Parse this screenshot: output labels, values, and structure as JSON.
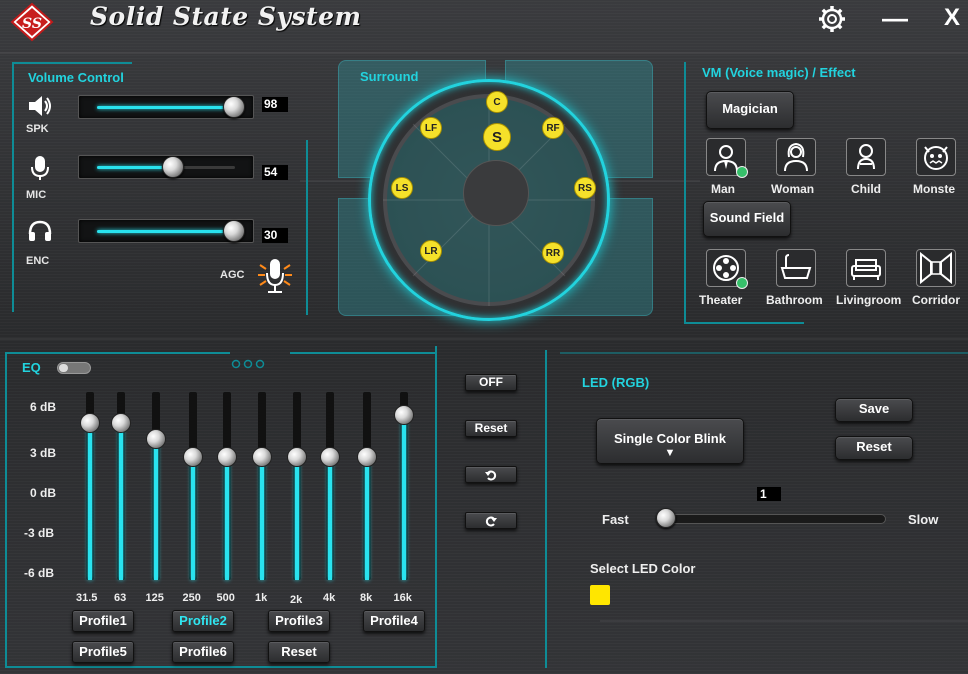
{
  "app": {
    "title": "Solid State System"
  },
  "window": {
    "settings_icon": "gear-icon",
    "minimize_label": "—",
    "close_label": "X"
  },
  "volume": {
    "title": "Volume Control",
    "channels": [
      {
        "label": "SPK",
        "value": "98",
        "level": 0.98,
        "icon": "speaker-icon"
      },
      {
        "label": "MIC",
        "value": "54",
        "level": 0.54,
        "icon": "microphone-icon"
      },
      {
        "label": "ENC",
        "value": "30",
        "level": 0.98,
        "icon": "headset-icon"
      }
    ],
    "agc_label": "AGC"
  },
  "surround": {
    "title": "Surround",
    "speakers": {
      "c": "C",
      "s": "S",
      "lf": "LF",
      "rf": "RF",
      "ls": "LS",
      "rs": "RS",
      "lr": "LR",
      "rr": "RR"
    },
    "speaker_color": "#f5e12a"
  },
  "vm": {
    "title": "VM (Voice magic) / Effect",
    "magician_label": "Magician",
    "voices": [
      {
        "label": "Man",
        "icon": "man-icon",
        "selected": true
      },
      {
        "label": "Woman",
        "icon": "woman-icon",
        "selected": false
      },
      {
        "label": "Child",
        "icon": "child-icon",
        "selected": false
      },
      {
        "label": "Monste",
        "icon": "monster-icon",
        "selected": false
      }
    ],
    "sound_field_label": "Sound Field",
    "fields": [
      {
        "label": "Theater",
        "icon": "theater-icon",
        "selected": true
      },
      {
        "label": "Bathroom",
        "icon": "bathtub-icon",
        "selected": false
      },
      {
        "label": "Livingroom",
        "icon": "sofa-icon",
        "selected": false
      },
      {
        "label": "Corridor",
        "icon": "corridor-icon",
        "selected": false
      }
    ]
  },
  "eq": {
    "title": "EQ",
    "enabled": false,
    "db_labels": [
      "6 dB",
      "3 dB",
      "0 dB",
      "-3 dB",
      "-6 dB"
    ],
    "bands": [
      {
        "freq": "31.5",
        "level_db": 5.0
      },
      {
        "freq": "63",
        "level_db": 5.0
      },
      {
        "freq": "125",
        "level_db": 3.8
      },
      {
        "freq": "250",
        "level_db": 2.5
      },
      {
        "freq": "500",
        "level_db": 2.5
      },
      {
        "freq": "1k",
        "level_db": 2.5
      },
      {
        "freq": "2k",
        "level_db": 2.5
      },
      {
        "freq": "4k",
        "level_db": 2.5
      },
      {
        "freq": "8k",
        "level_db": 2.5
      },
      {
        "freq": "16k",
        "level_db": 5.6
      }
    ],
    "profiles_row1": [
      "Profile1",
      "Profile2",
      "Profile3",
      "Profile4"
    ],
    "profiles_row2": [
      "Profile5",
      "Profile6"
    ],
    "active_profile": "Profile2",
    "reset_label": "Reset"
  },
  "side_buttons": {
    "off": "OFF",
    "reset": "Reset",
    "undo_icon": "undo-icon",
    "redo_icon": "redo-icon"
  },
  "led": {
    "title": "LED (RGB)",
    "mode": "Single Color Blink",
    "mode_arrow": "▼",
    "save_label": "Save",
    "reset_label": "Reset",
    "speed_value": "1",
    "speed_level": 0.0,
    "fast_label": "Fast",
    "slow_label": "Slow",
    "select_color_label": "Select LED Color",
    "selected_color": "#ffe600"
  },
  "accent_color": "#22d3de"
}
